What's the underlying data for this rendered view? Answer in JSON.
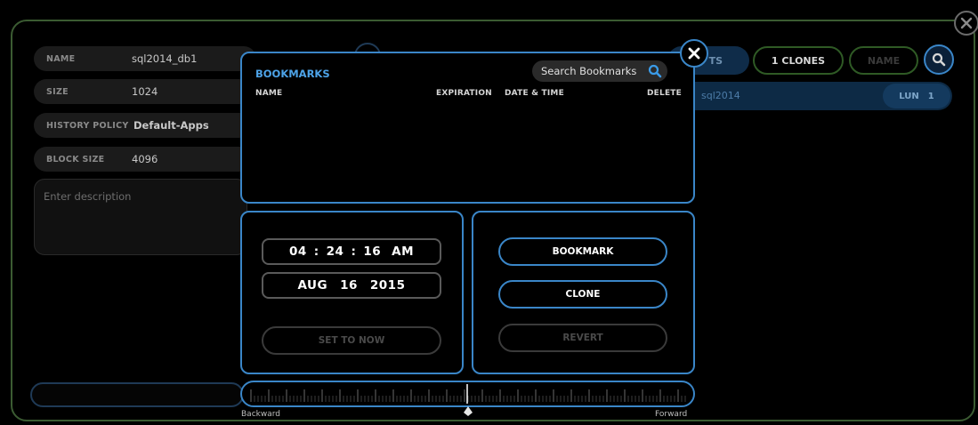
{
  "fields": [
    {
      "label": "NAME",
      "value": "sql2014_db1",
      "bold": false
    },
    {
      "label": "SIZE",
      "value": "1024",
      "bold": false
    },
    {
      "label": "HISTORY POLICY",
      "value": "Default-Apps",
      "bold": true
    },
    {
      "label": "BLOCK SIZE",
      "value": "4096",
      "bold": false
    }
  ],
  "description": {
    "placeholder": "Enter description"
  },
  "right": {
    "tab_partial": "TS",
    "clones_label": "1 CLONES",
    "name_partial": "NAME",
    "row_name": "sql2014",
    "lun_label": "LUN",
    "lun_value": "1"
  },
  "bookmarks": {
    "title": "BOOKMARKS",
    "search_label": "Search Bookmarks",
    "columns": {
      "name": "NAME",
      "expiration": "EXPIRATION",
      "date_time": "DATE & TIME",
      "delete": "DELETE"
    }
  },
  "time": {
    "hh": "04",
    "mm": "24",
    "ss": "16",
    "ampm": "AM",
    "month": "AUG",
    "day": "16",
    "year": "2015",
    "set_to_now_label": "SET TO NOW"
  },
  "actions": {
    "bookmark_label": "BOOKMARK",
    "clone_label": "CLONE",
    "revert_label": "REVERT"
  },
  "timeline": {
    "backward_label": "Backward",
    "forward_label": "Forward"
  },
  "colors": {
    "accent": "#3a86c8",
    "frame": "#3b5b32",
    "clones_border": "#2f5a25"
  }
}
